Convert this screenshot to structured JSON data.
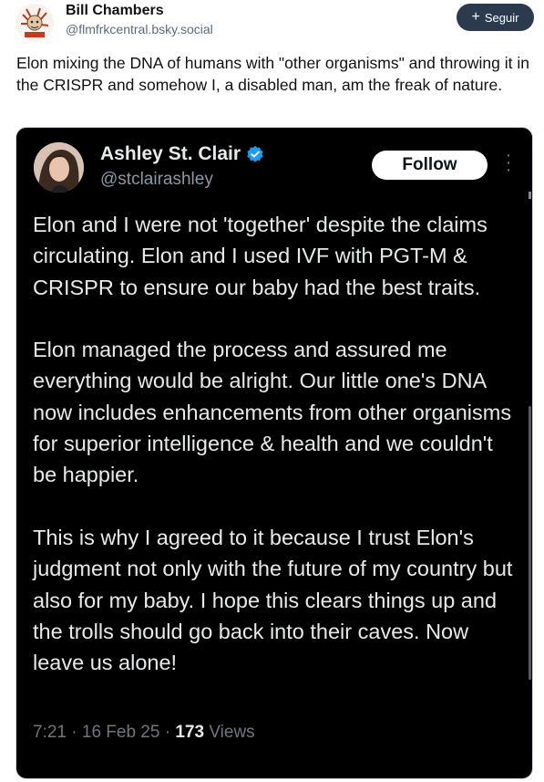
{
  "post": {
    "author_name": "Bill Chambers",
    "author_handle": "@flmfrkcentral.bsky.social",
    "follow_label": "Seguir",
    "text": "Elon mixing the DNA of humans with \"other organisms\" and throwing it in the CRISPR and somehow I, a disabled man, am the freak of nature."
  },
  "embed": {
    "author_name": "Ashley St. Clair",
    "author_handle": "@stclairashley",
    "follow_label": "Follow",
    "paragraphs": [
      "Elon and I were not 'together' despite the claims circulating. Elon and I used IVF with PGT-M & CRISPR to ensure our baby had the best traits.",
      "Elon managed the process and assured me everything would be alright. Our little one's DNA now includes enhancements from other organisms for superior intelligence & health and we couldn't be happier.",
      "This is why I agreed to it because I trust Elon's judgment not only with the future of my country but also for my baby. I hope this clears things up and the trolls should go back into their caves. Now leave us alone!"
    ],
    "time": "7:21",
    "date": "16 Feb 25",
    "views_count": "173",
    "views_label": "Views",
    "separator": "·"
  },
  "icons": {
    "outer_avatar": "avatar-illustration",
    "verified": "verified-badge-icon",
    "more": "more-dots-icon",
    "plus": "plus-icon"
  },
  "colors": {
    "follow_button_bg": "#2b3a4f",
    "verified_blue": "#1d9bf0",
    "embed_bg": "#000000"
  }
}
